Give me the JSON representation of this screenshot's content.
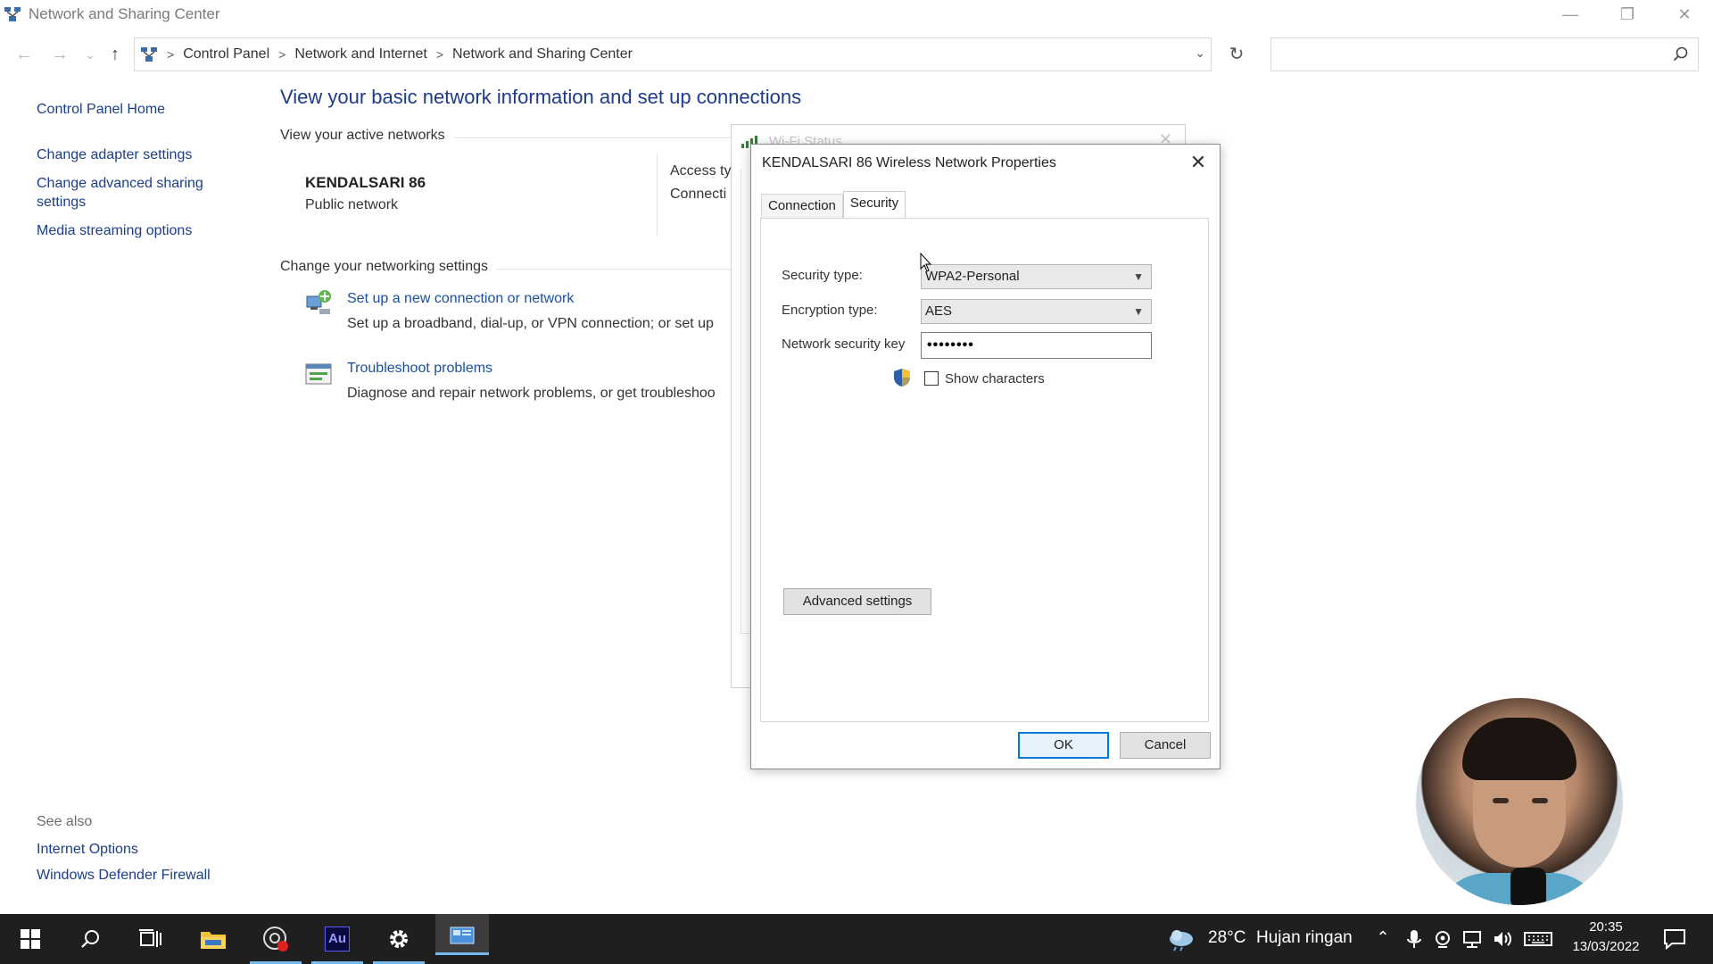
{
  "window": {
    "title": "Network and Sharing Center",
    "minimize": "—",
    "restore": "❐",
    "close": "✕"
  },
  "nav": {
    "back": "←",
    "forward": "→",
    "recent": "⌄",
    "up": "↑",
    "breadcrumbs": [
      "Control Panel",
      "Network and Internet",
      "Network and Sharing Center"
    ],
    "separator": ">",
    "dropdown": "⌄",
    "refresh": "↻",
    "search_placeholder": ""
  },
  "sidebar": {
    "items": [
      {
        "label": "Control Panel Home"
      },
      {
        "label": "Change adapter settings"
      },
      {
        "label": "Change advanced sharing settings"
      },
      {
        "label": "Media streaming options"
      }
    ],
    "see_also_label": "See also",
    "see_also": [
      {
        "label": "Internet Options"
      },
      {
        "label": "Windows Defender Firewall"
      }
    ]
  },
  "main": {
    "heading": "View your basic network information and set up connections",
    "active_networks_label": "View your active networks",
    "network_name": "KENDALSARI 86",
    "network_type": "Public network",
    "access_type_label": "Access ty",
    "connections_label": "Connecti",
    "networking_settings_label": "Change your networking settings",
    "tasks": [
      {
        "link": "Set up a new connection or network",
        "desc": "Set up a broadband, dial-up, or VPN connection; or set up"
      },
      {
        "link": "Troubleshoot problems",
        "desc": "Diagnose and repair network problems, or get troubleshoo"
      }
    ]
  },
  "wifi_status_dialog": {
    "title": "Wi-Fi Status",
    "close": "✕"
  },
  "properties_dialog": {
    "title": "KENDALSARI 86 Wireless Network Properties",
    "close": "✕",
    "tabs": [
      {
        "label": "Connection",
        "active": false
      },
      {
        "label": "Security",
        "active": true
      }
    ],
    "security_type_label": "Security type:",
    "security_type_value": "WPA2-Personal",
    "encryption_type_label": "Encryption type:",
    "encryption_type_value": "AES",
    "key_label": "Network security key",
    "key_value": "••••••••",
    "show_characters_label": "Show characters",
    "show_characters_checked": false,
    "advanced_button": "Advanced settings",
    "ok_button": "OK",
    "cancel_button": "Cancel"
  },
  "taskbar": {
    "weather_temp": "28°C",
    "weather_text": "Hujan ringan",
    "time": "20:35",
    "date": "13/03/2022",
    "au_label": "Au",
    "accent": "#76b9ed"
  }
}
